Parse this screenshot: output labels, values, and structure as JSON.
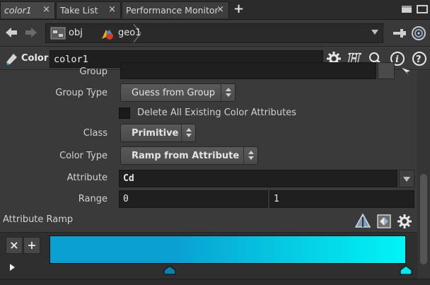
{
  "tabs": [
    {
      "label": "color1",
      "close": "×"
    },
    {
      "label": "Take List",
      "close": "×"
    },
    {
      "label": "Performance Monitor",
      "close": "×"
    }
  ],
  "tab_add": "+",
  "path": {
    "obj": "obj",
    "geo": "geo1"
  },
  "node": {
    "type_label": "Color",
    "name": "color1"
  },
  "params": {
    "group_label": "Group",
    "group_type_label": "Group Type",
    "group_type_value": "Guess from Group",
    "delete_existing_label": "Delete All Existing Color Attributes",
    "class_label": "Class",
    "class_value": "Primitive",
    "color_type_label": "Color Type",
    "color_type_value": "Ramp from Attribute",
    "attribute_label": "Attribute",
    "attribute_value": "Cd",
    "range_label": "Range",
    "range_min": "0",
    "range_max": "1",
    "ramp_label": "Attribute Ramp"
  },
  "ramp": {
    "remove": "×",
    "add": "+",
    "color_start": "#0a9fd1",
    "color_end": "#00f5f5"
  },
  "colors": {
    "accent": "#00b8e6",
    "panel": "#3a3a3a",
    "field": "#1f1f1f"
  }
}
